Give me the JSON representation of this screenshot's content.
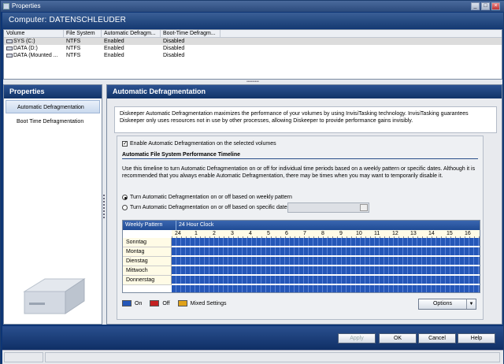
{
  "window": {
    "title": "Properties"
  },
  "header": {
    "title": "Computer: DATENSCHLEUDER"
  },
  "volumes": {
    "columns": [
      "Volume",
      "File System",
      "Automatic Defragm...",
      "Boot-Time Defragm..."
    ],
    "rows": [
      {
        "volume": "SYS (C:)",
        "fs": "NTFS",
        "auto": "Enabled",
        "boot": "Disabled"
      },
      {
        "volume": "DATA (D:)",
        "fs": "NTFS",
        "auto": "Enabled",
        "boot": "Disabled"
      },
      {
        "volume": "DATA (Mounted ...",
        "fs": "NTFS",
        "auto": "Enabled",
        "boot": "Disabled"
      }
    ]
  },
  "sidebar": {
    "title": "Properties",
    "items": [
      {
        "label": "Automatic Defragmentation"
      },
      {
        "label": "Boot Time Defragmentation"
      }
    ]
  },
  "main": {
    "title": "Automatic Defragmentation",
    "description": "Diskeeper Automatic Defragmentation maximizes the performance of your volumes by using InvisiTasking technology. InvisiTasking guarantees Diskeeper only uses resources not in use by other processes, allowing Diskeeper to provide performance gains invisibly.",
    "enable_label": "Enable Automatic Defragmentation on the selected volumes",
    "section_title": "Automatic File System Performance Timeline",
    "help_text": "Use this timeline to turn Automatic Defragmentation on or off for individual time periods based on a weekly pattern or specific dates. Although it is recommended that you always enable Automatic Defragmentation, there may be times when you may want to temporarily disable it.",
    "radio_weekly": "Turn Automatic Defragmentation on or off based on weekly pattern",
    "radio_dates": "Turn Automatic Defragmentation on or off based on specific dates:",
    "timeline": {
      "weekly_pattern_label": "Weekly Pattern",
      "clock_label": "24 Hour Clock",
      "hours": [
        "24",
        "1",
        "2",
        "3",
        "4",
        "5",
        "6",
        "7",
        "8",
        "9",
        "10",
        "11",
        "12",
        "13",
        "14",
        "15",
        "16"
      ],
      "days": [
        "Sonntag",
        "Montag",
        "Dienstag",
        "Mittwoch",
        "Donnerstag"
      ]
    },
    "legend": {
      "on": "On",
      "off": "Off",
      "mixed": "Mixed Settings",
      "on_color": "#2557b8",
      "off_color": "#c42121",
      "mixed_color": "#e0a21a"
    },
    "options_label": "Options"
  },
  "buttons": {
    "apply": "Apply",
    "ok": "OK",
    "cancel": "Cancel",
    "help": "Help"
  }
}
